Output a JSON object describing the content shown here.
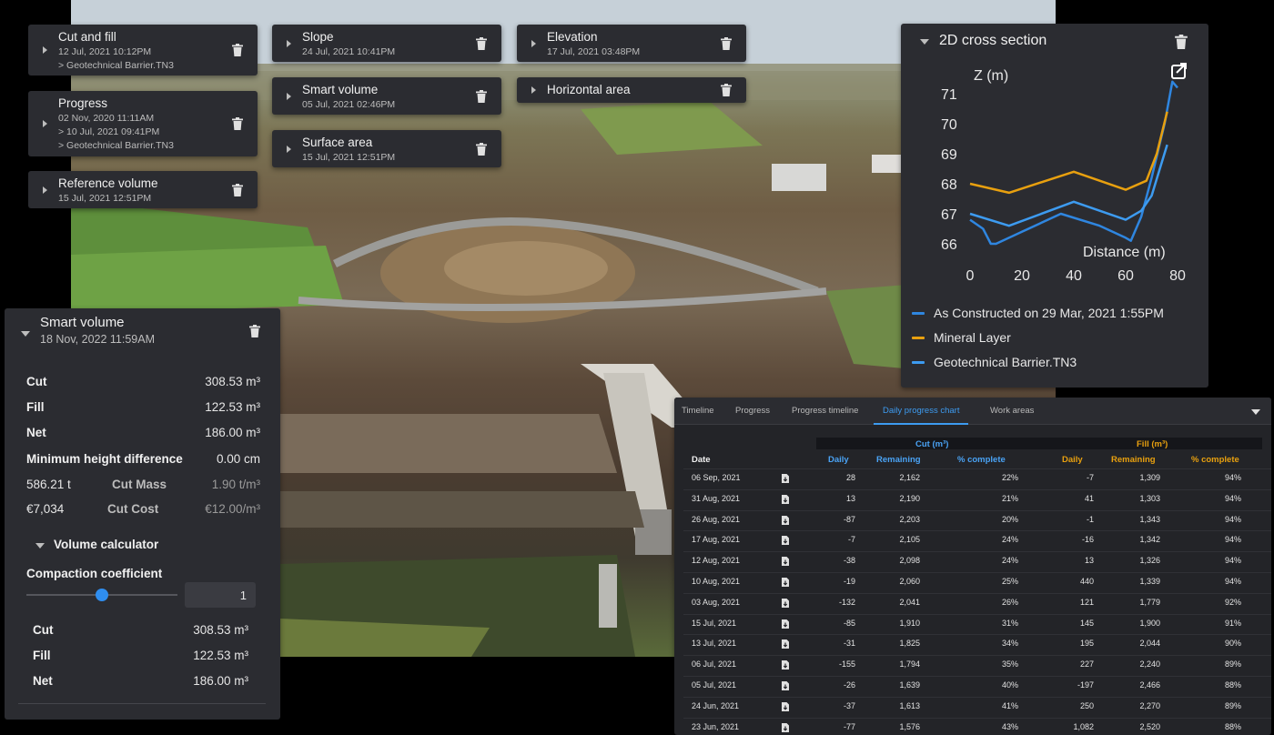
{
  "tool_cards": [
    {
      "title": "Cut and fill",
      "lines": [
        "12 Jul, 2021 10:12PM",
        "> Geotechnical Barrier.TN3"
      ]
    },
    {
      "title": "Progress",
      "lines": [
        "02 Nov, 2020 11:11AM",
        "> 10 Jul, 2021 09:41PM",
        "> Geotechnical Barrier.TN3"
      ]
    },
    {
      "title": "Reference volume",
      "lines": [
        "15 Jul, 2021 12:51PM"
      ]
    },
    {
      "title": "Slope",
      "lines": [
        "24 Jul, 2021 10:41PM"
      ]
    },
    {
      "title": "Smart volume",
      "lines": [
        "05 Jul, 2021 02:46PM"
      ]
    },
    {
      "title": "Surface area",
      "lines": [
        "15 Jul, 2021 12:51PM"
      ]
    },
    {
      "title": "Elevation",
      "lines": [
        "17 Jul, 2021 03:48PM"
      ]
    },
    {
      "title": "Horizontal area",
      "lines": []
    }
  ],
  "cross_section": {
    "title": "2D cross section",
    "ylabel": "Z (m)",
    "xlabel": "Distance (m)",
    "y_ticks": [
      "71",
      "70",
      "69",
      "68",
      "67",
      "66"
    ],
    "x_ticks": [
      "0",
      "20",
      "40",
      "60",
      "80"
    ],
    "legend": [
      {
        "label": "As Constructed on 29 Mar, 2021 1:55PM",
        "color": "#2f86e0"
      },
      {
        "label": "Mineral Layer",
        "color": "#e8a00f"
      },
      {
        "label": "Geotechnical Barrier.TN3",
        "color": "#3d9bf0"
      }
    ]
  },
  "chart_data": {
    "type": "line",
    "xlabel": "Distance (m)",
    "ylabel": "Z (m)",
    "xlim": [
      0,
      80
    ],
    "ylim": [
      66,
      71.5
    ],
    "series": [
      {
        "name": "As Constructed on 29 Mar, 2021 1:55PM",
        "x": [
          0,
          5,
          8,
          10,
          20,
          35,
          50,
          60,
          62,
          66,
          70,
          75,
          78,
          80
        ],
        "y": [
          66.8,
          66.5,
          66.0,
          66.0,
          66.4,
          67.0,
          66.6,
          66.2,
          66.1,
          66.9,
          68.2,
          70.0,
          71.4,
          71.2
        ]
      },
      {
        "name": "Mineral Layer",
        "x": [
          0,
          15,
          40,
          60,
          68,
          72,
          76
        ],
        "y": [
          68.0,
          67.7,
          68.4,
          67.8,
          68.1,
          69.0,
          70.4
        ]
      },
      {
        "name": "Geotechnical Barrier.TN3",
        "x": [
          0,
          15,
          40,
          60,
          66,
          70,
          76
        ],
        "y": [
          67.0,
          66.6,
          67.4,
          66.8,
          67.1,
          67.6,
          69.3
        ]
      }
    ]
  },
  "smart_volume": {
    "title": "Smart volume",
    "date": "18 Nov, 2022 11:59AM",
    "cut_label": "Cut",
    "cut_value": "308.53 m³",
    "fill_label": "Fill",
    "fill_value": "122.53 m³",
    "net_label": "Net",
    "net_value": "186.00 m³",
    "min_height_label": "Minimum height difference",
    "min_height_value": "0.00 cm",
    "cut_mass_value": "586.21 t",
    "cut_mass_label": "Cut Mass",
    "cut_mass_rate": "1.90 t/m³",
    "cut_cost_value": "€7,034",
    "cut_cost_label": "Cut Cost",
    "cut_cost_rate": "€12.00/m³",
    "calculator_title": "Volume calculator",
    "compaction_label": "Compaction coefficient",
    "compaction_value": "1",
    "slider_fraction": 0.5,
    "calc_cut_label": "Cut",
    "calc_cut_value": "308.53 m³",
    "calc_fill_label": "Fill",
    "calc_fill_value": "122.53 m³",
    "calc_net_label": "Net",
    "calc_net_value": "186.00 m³"
  },
  "table": {
    "tabs": [
      "Timeline",
      "Progress",
      "Progress timeline",
      "Daily progress chart",
      "Work areas"
    ],
    "active_tab": "Daily progress chart",
    "date_header": "Date",
    "cut_group": "Cut (m³)",
    "fill_group": "Fill (m³)",
    "sub_headers": [
      "Daily",
      "Remaining",
      "% complete",
      "Daily",
      "Remaining",
      "% complete"
    ],
    "rows": [
      [
        "06 Sep, 2021",
        "28",
        "2,162",
        "22%",
        "-7",
        "1,309",
        "94%"
      ],
      [
        "31 Aug, 2021",
        "13",
        "2,190",
        "21%",
        "41",
        "1,303",
        "94%"
      ],
      [
        "26 Aug, 2021",
        "-87",
        "2,203",
        "20%",
        "-1",
        "1,343",
        "94%"
      ],
      [
        "17 Aug, 2021",
        "-7",
        "2,105",
        "24%",
        "-16",
        "1,342",
        "94%"
      ],
      [
        "12 Aug, 2021",
        "-38",
        "2,098",
        "24%",
        "13",
        "1,326",
        "94%"
      ],
      [
        "10 Aug, 2021",
        "-19",
        "2,060",
        "25%",
        "440",
        "1,339",
        "94%"
      ],
      [
        "03 Aug, 2021",
        "-132",
        "2,041",
        "26%",
        "121",
        "1,779",
        "92%"
      ],
      [
        "15 Jul, 2021",
        "-85",
        "1,910",
        "31%",
        "145",
        "1,900",
        "91%"
      ],
      [
        "13 Jul, 2021",
        "-31",
        "1,825",
        "34%",
        "195",
        "2,044",
        "90%"
      ],
      [
        "06 Jul, 2021",
        "-155",
        "1,794",
        "35%",
        "227",
        "2,240",
        "89%"
      ],
      [
        "05 Jul, 2021",
        "-26",
        "1,639",
        "40%",
        "-197",
        "2,466",
        "88%"
      ],
      [
        "24 Jun, 2021",
        "-37",
        "1,613",
        "41%",
        "250",
        "2,270",
        "89%"
      ],
      [
        "23 Jun, 2021",
        "-77",
        "1,576",
        "43%",
        "1,082",
        "2,520",
        "88%"
      ]
    ]
  }
}
